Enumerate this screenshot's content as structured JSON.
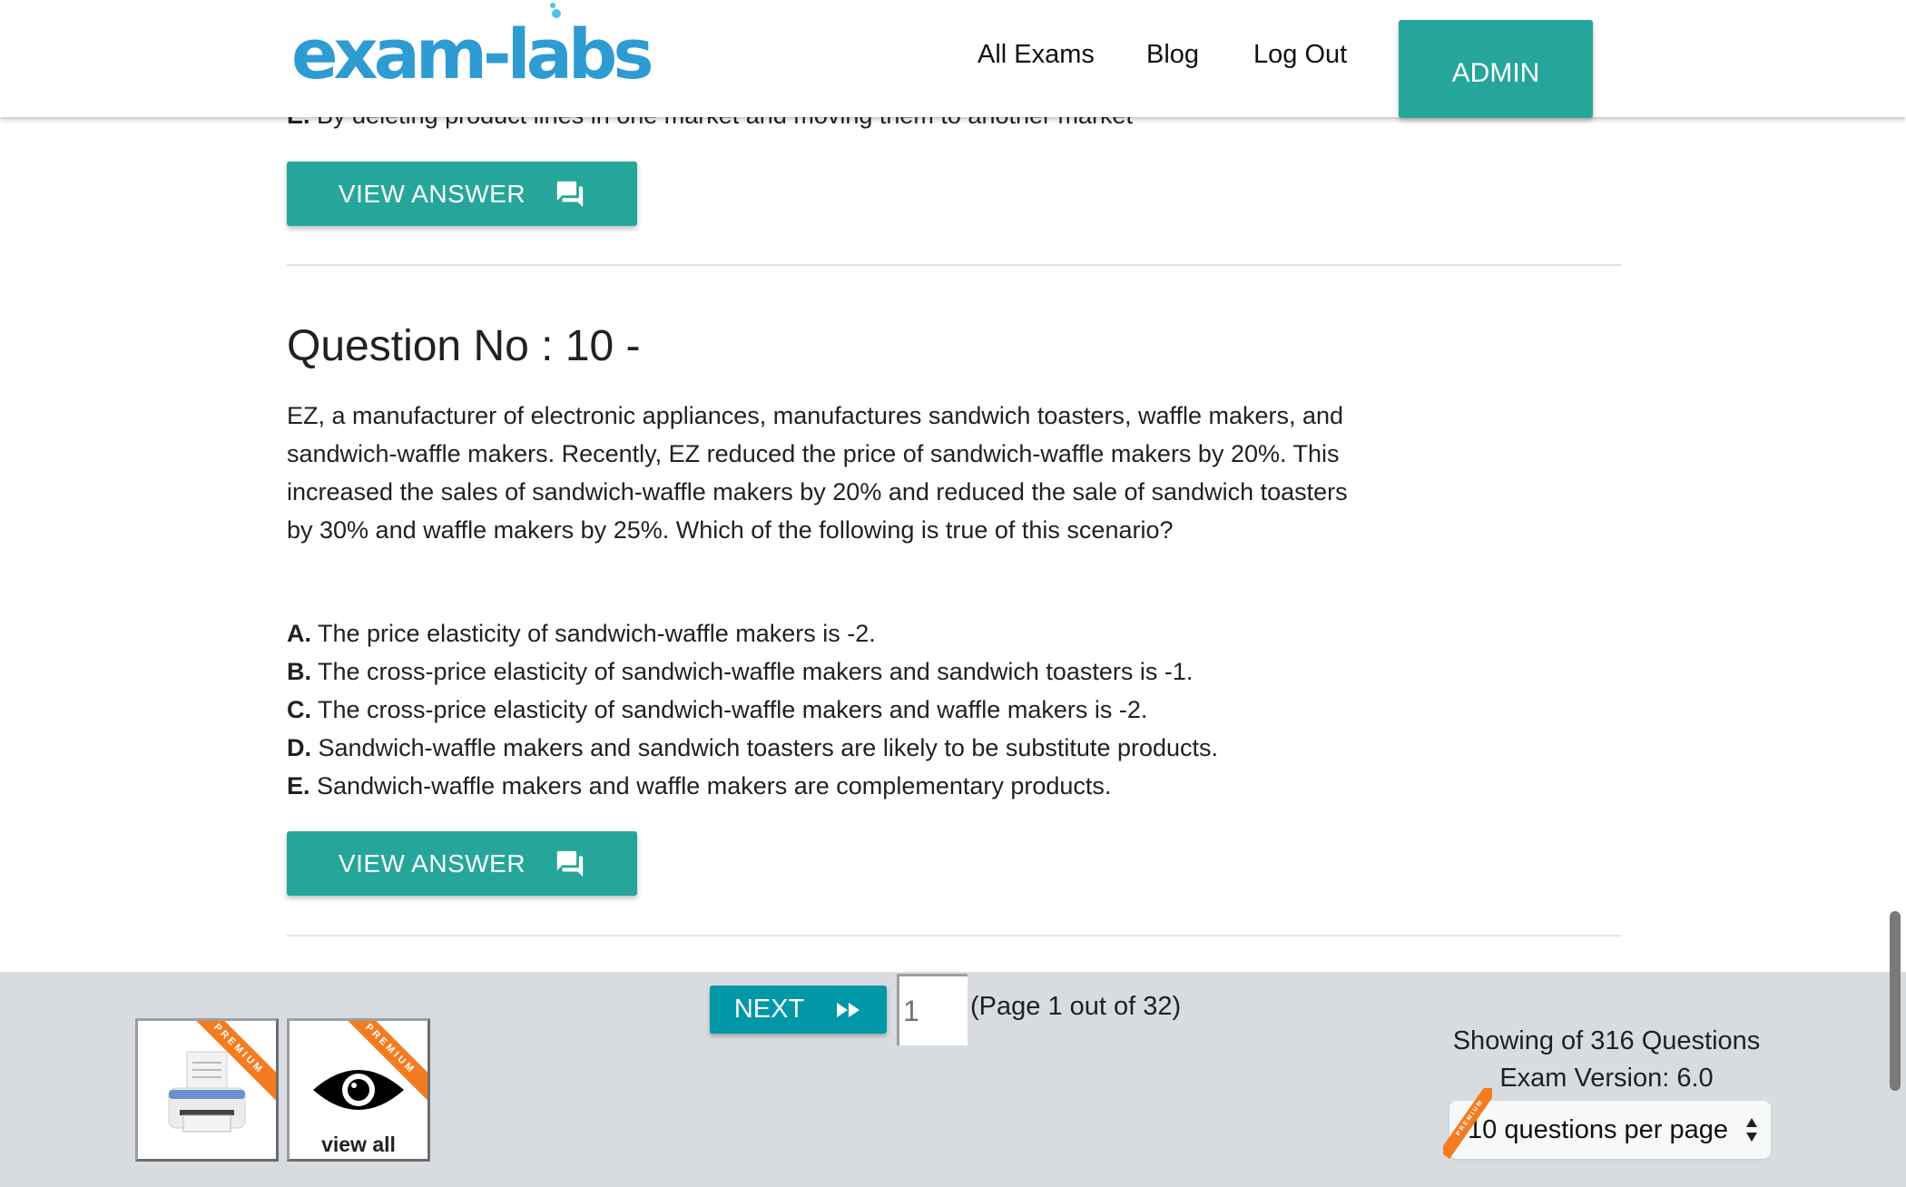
{
  "header": {
    "logo": "exam-labs",
    "nav": [
      {
        "label": "All Exams"
      },
      {
        "label": "Blog"
      },
      {
        "label": "Log Out"
      }
    ],
    "admin_label": "ADMIN"
  },
  "previous_question": {
    "last_option_letter": "E.",
    "last_option_text": "By deleting product lines in one market and moving them to another market",
    "view_answer_label": "VIEW ANSWER"
  },
  "question": {
    "title": "Question No : 10 -",
    "body": "EZ, a manufacturer of electronic appliances, manufactures sandwich toasters, waffle makers, and sandwich-waffle makers. Recently, EZ reduced the price of sandwich-waffle makers by 20%. This increased the sales of sandwich-waffle makers by 20% and reduced the sale of sandwich toasters by 30% and waffle makers by 25%. Which of the following is true of this scenario?",
    "options": [
      {
        "letter": "A.",
        "text": "The price elasticity of sandwich-waffle makers is -2."
      },
      {
        "letter": "B.",
        "text": "The cross-price elasticity of sandwich-waffle makers and sandwich toasters is -1."
      },
      {
        "letter": "C.",
        "text": "The cross-price elasticity of sandwich-waffle makers and waffle makers is -2."
      },
      {
        "letter": "D.",
        "text": "Sandwich-waffle makers and sandwich toasters are likely to be substitute products."
      },
      {
        "letter": "E.",
        "text": "Sandwich-waffle makers and waffle makers are complementary products."
      }
    ],
    "view_answer_label": "VIEW ANSWER"
  },
  "footer": {
    "next_label": "NEXT",
    "page_input_placeholder": "1",
    "page_text": "(Page 1 out of 32)",
    "tiles": [
      {
        "icon": "printer-icon",
        "ribbon": "PREMIUM",
        "label": ""
      },
      {
        "icon": "eye-icon",
        "ribbon": "PREMIUM",
        "label": "view all"
      }
    ],
    "showing_text": "Showing of 316 Questions",
    "exam_version_text": "Exam Version: 6.0",
    "per_page_selected": "10 questions per page",
    "per_page_ribbon": "PREMIUM"
  },
  "colors": {
    "accent": "#26a69a",
    "next": "#0097a7",
    "logo": "#2e9bd2",
    "ribbon": "#f47c20",
    "footer_bg": "#d8dce0"
  }
}
